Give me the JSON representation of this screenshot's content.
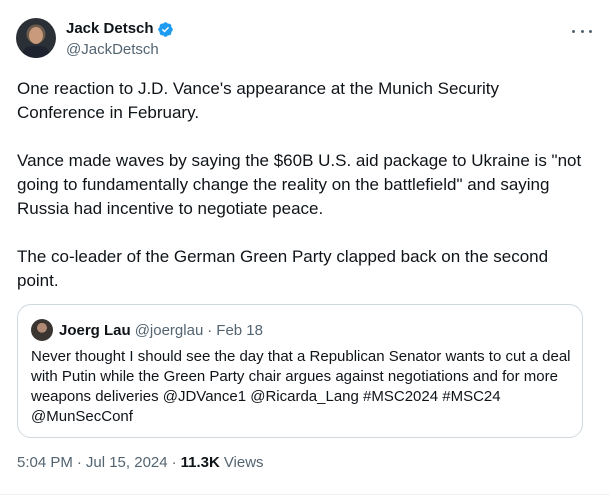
{
  "author": {
    "display_name": "Jack Detsch",
    "handle": "@JackDetsch",
    "verified": true
  },
  "icons": {
    "verified": "verified-badge-icon",
    "more": "more-icon"
  },
  "colors": {
    "text": "#0f1419",
    "secondary": "#536471",
    "verified": "#1d9bf0",
    "border": "#cfd9de"
  },
  "tweet": {
    "paragraphs": [
      "One reaction to J.D. Vance's appearance at the Munich Security Conference in February.",
      "Vance made waves by saying the $60B U.S. aid package to Ukraine is \"not going to fundamentally change the reality on the battlefield\" and saying Russia had incentive to negotiate peace.",
      "The co-leader of the German Green Party clapped back on the second point."
    ]
  },
  "quote": {
    "display_name": "Joerg Lau",
    "handle": "@joerglau",
    "separator": "·",
    "date": "Feb 18",
    "text": "Never thought I should see the day that a Republican Senator wants to cut a deal with Putin while the Green Party chair argues against negotiations and for more weapons deliveries @JDVance1 @Ricarda_Lang #MSC2024 #MSC24 @MunSecConf"
  },
  "meta": {
    "time": "5:04 PM",
    "separator": "·",
    "date": "Jul 15, 2024",
    "views_count": "11.3K",
    "views_label": "Views"
  }
}
